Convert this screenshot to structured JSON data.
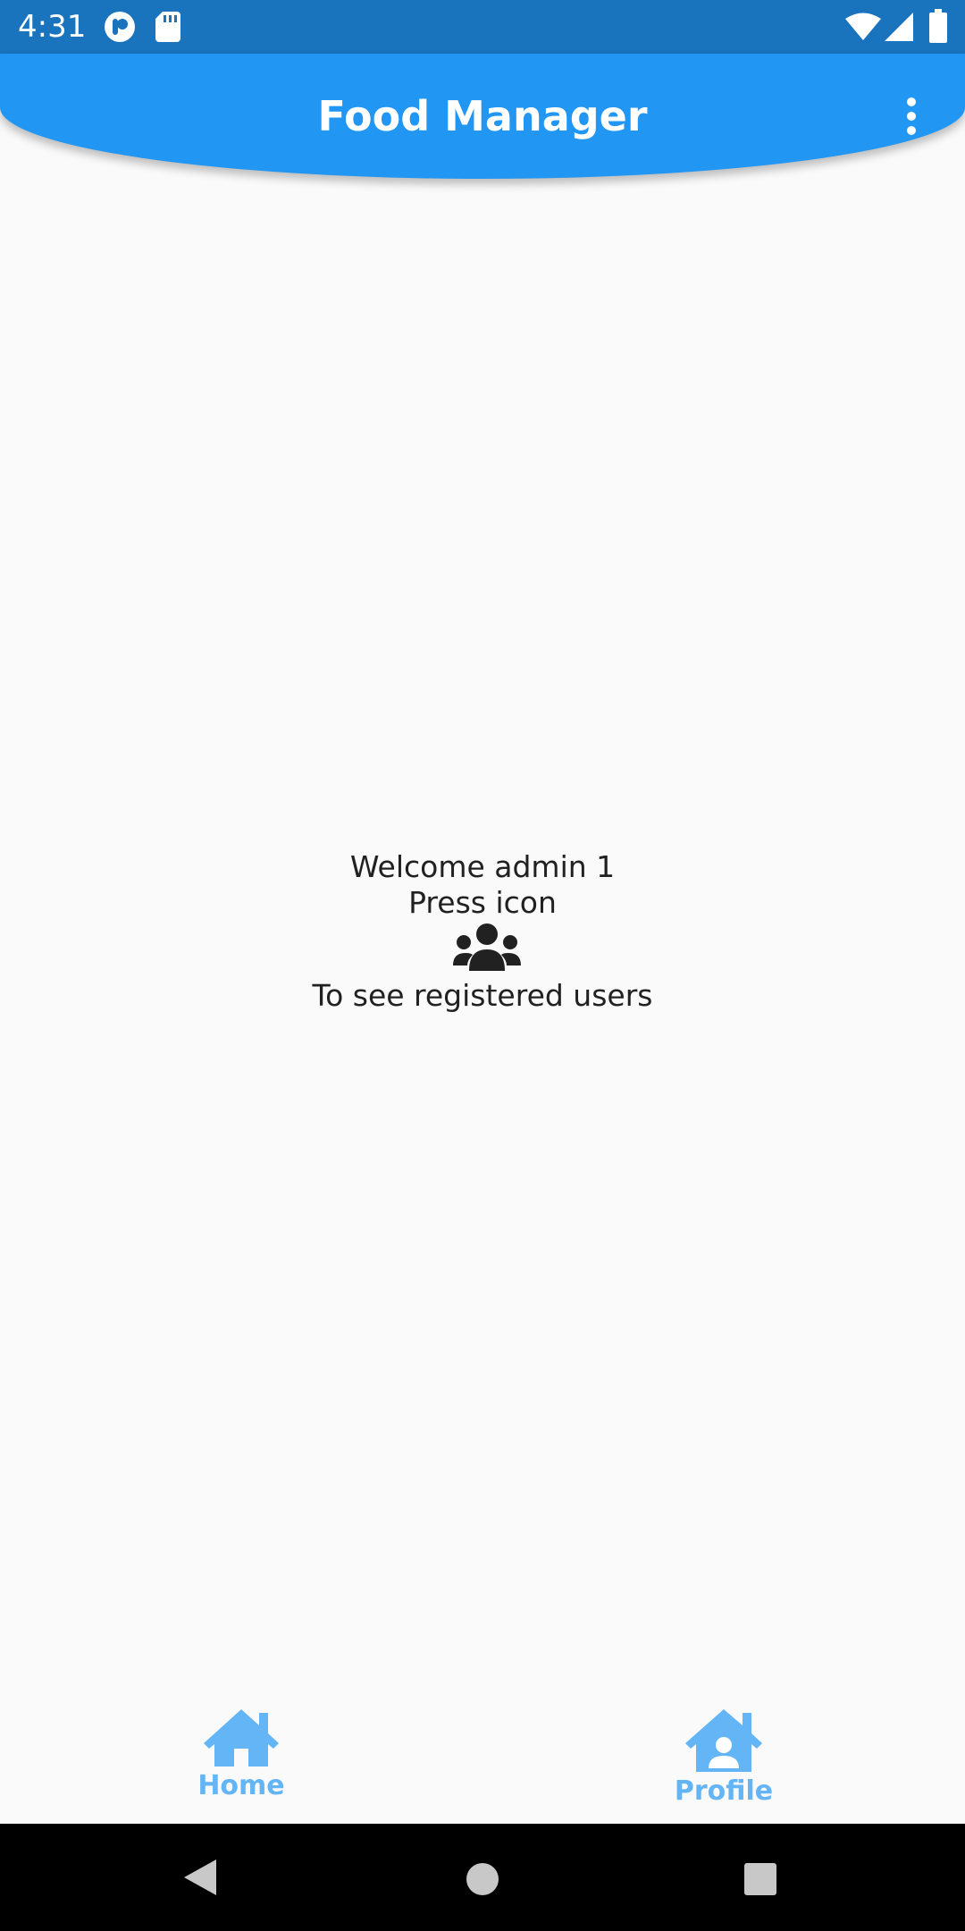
{
  "status_bar": {
    "time": "4:31",
    "icons": [
      "notification-app-icon",
      "sd-card-icon",
      "wifi-icon",
      "cell-signal-icon",
      "battery-icon"
    ]
  },
  "app_bar": {
    "title": "Food Manager",
    "menu_icon": "more-vert-icon"
  },
  "main": {
    "welcome_text": "Welcome admin 1",
    "instruction_text": "Press icon",
    "icon": "users-icon",
    "hint_text": "To see registered users"
  },
  "bottom_nav": {
    "items": [
      {
        "label": "Home",
        "icon": "home-icon"
      },
      {
        "label": "Profile",
        "icon": "profile-home-icon"
      }
    ]
  },
  "system_nav": {
    "buttons": [
      "back-icon",
      "home-circle-icon",
      "recents-icon"
    ]
  },
  "colors": {
    "status_bar": "#1a73bd",
    "app_bar": "#2196f3",
    "nav_active": "#64b5f6",
    "background": "#fafafa",
    "text": "#212121"
  }
}
